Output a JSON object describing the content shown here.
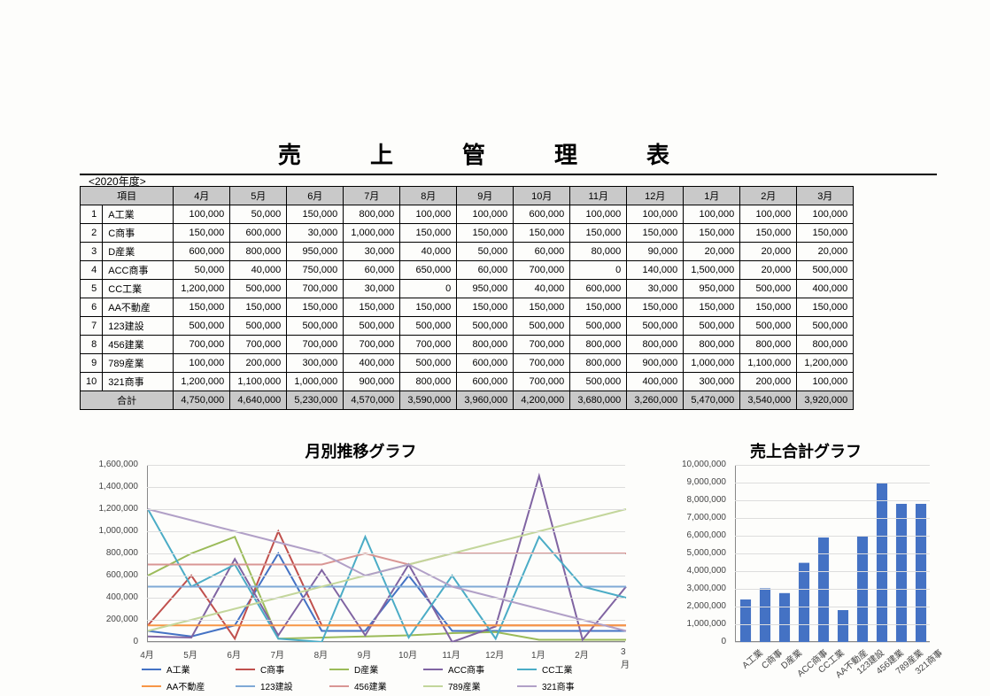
{
  "title": "売上管理表",
  "fiscal_label": "<2020年度>",
  "header_item": "項目",
  "months": [
    "4月",
    "5月",
    "6月",
    "7月",
    "8月",
    "9月",
    "10月",
    "11月",
    "12月",
    "1月",
    "2月",
    "3月"
  ],
  "rows": [
    {
      "idx": 1,
      "name": "A工業",
      "vals": [
        100000,
        50000,
        150000,
        800000,
        100000,
        100000,
        600000,
        100000,
        100000,
        100000,
        100000,
        100000
      ]
    },
    {
      "idx": 2,
      "name": "C商事",
      "vals": [
        150000,
        600000,
        30000,
        1000000,
        150000,
        150000,
        150000,
        150000,
        150000,
        150000,
        150000,
        150000
      ]
    },
    {
      "idx": 3,
      "name": "D産業",
      "vals": [
        600000,
        800000,
        950000,
        30000,
        40000,
        50000,
        60000,
        80000,
        90000,
        20000,
        20000,
        20000
      ]
    },
    {
      "idx": 4,
      "name": "ACC商事",
      "vals": [
        50000,
        40000,
        750000,
        60000,
        650000,
        60000,
        700000,
        0,
        140000,
        1500000,
        20000,
        500000
      ]
    },
    {
      "idx": 5,
      "name": "CC工業",
      "vals": [
        1200000,
        500000,
        700000,
        30000,
        0,
        950000,
        40000,
        600000,
        30000,
        950000,
        500000,
        400000
      ]
    },
    {
      "idx": 6,
      "name": "AA不動産",
      "vals": [
        150000,
        150000,
        150000,
        150000,
        150000,
        150000,
        150000,
        150000,
        150000,
        150000,
        150000,
        150000
      ]
    },
    {
      "idx": 7,
      "name": "123建設",
      "vals": [
        500000,
        500000,
        500000,
        500000,
        500000,
        500000,
        500000,
        500000,
        500000,
        500000,
        500000,
        500000
      ]
    },
    {
      "idx": 8,
      "name": "456建業",
      "vals": [
        700000,
        700000,
        700000,
        700000,
        700000,
        800000,
        700000,
        800000,
        800000,
        800000,
        800000,
        800000
      ]
    },
    {
      "idx": 9,
      "name": "789産業",
      "vals": [
        100000,
        200000,
        300000,
        400000,
        500000,
        600000,
        700000,
        800000,
        900000,
        1000000,
        1100000,
        1200000
      ]
    },
    {
      "idx": 10,
      "name": "321商事",
      "vals": [
        1200000,
        1100000,
        1000000,
        900000,
        800000,
        600000,
        700000,
        500000,
        400000,
        300000,
        200000,
        100000
      ]
    }
  ],
  "total_label": "合計",
  "totals": [
    4750000,
    4640000,
    5230000,
    4570000,
    3590000,
    3960000,
    4200000,
    3680000,
    3260000,
    5470000,
    3540000,
    3920000
  ],
  "line_chart_title": "月別推移グラフ",
  "bar_chart_title": "売上合計グラフ",
  "chart_data": [
    {
      "type": "line",
      "title": "月別推移グラフ",
      "categories": [
        "4月",
        "5月",
        "6月",
        "7月",
        "8月",
        "9月",
        "10月",
        "11月",
        "12月",
        "1月",
        "2月",
        "3月"
      ],
      "ylim": [
        0,
        1600000
      ],
      "ytick_step": 200000,
      "series": [
        {
          "name": "A工業",
          "color": "#4472c4",
          "values": [
            100000,
            50000,
            150000,
            800000,
            100000,
            100000,
            600000,
            100000,
            100000,
            100000,
            100000,
            100000
          ]
        },
        {
          "name": "C商事",
          "color": "#c0504d",
          "values": [
            150000,
            600000,
            30000,
            1000000,
            150000,
            150000,
            150000,
            150000,
            150000,
            150000,
            150000,
            150000
          ]
        },
        {
          "name": "D産業",
          "color": "#9bbb59",
          "values": [
            600000,
            800000,
            950000,
            30000,
            40000,
            50000,
            60000,
            80000,
            90000,
            20000,
            20000,
            20000
          ]
        },
        {
          "name": "ACC商事",
          "color": "#8064a2",
          "values": [
            50000,
            40000,
            750000,
            60000,
            650000,
            60000,
            700000,
            0,
            140000,
            1500000,
            20000,
            500000
          ]
        },
        {
          "name": "CC工業",
          "color": "#4bacc6",
          "values": [
            1200000,
            500000,
            700000,
            30000,
            0,
            950000,
            40000,
            600000,
            30000,
            950000,
            500000,
            400000
          ]
        },
        {
          "name": "AA不動産",
          "color": "#f79646",
          "values": [
            150000,
            150000,
            150000,
            150000,
            150000,
            150000,
            150000,
            150000,
            150000,
            150000,
            150000,
            150000
          ]
        },
        {
          "name": "123建設",
          "color": "#7fa9d6",
          "values": [
            500000,
            500000,
            500000,
            500000,
            500000,
            500000,
            500000,
            500000,
            500000,
            500000,
            500000,
            500000
          ]
        },
        {
          "name": "456建業",
          "color": "#d99694",
          "values": [
            700000,
            700000,
            700000,
            700000,
            700000,
            800000,
            700000,
            800000,
            800000,
            800000,
            800000,
            800000
          ]
        },
        {
          "name": "789産業",
          "color": "#c3d69b",
          "values": [
            100000,
            200000,
            300000,
            400000,
            500000,
            600000,
            700000,
            800000,
            900000,
            1000000,
            1100000,
            1200000
          ]
        },
        {
          "name": "321商事",
          "color": "#b1a0c7",
          "values": [
            1200000,
            1100000,
            1000000,
            900000,
            800000,
            600000,
            700000,
            500000,
            400000,
            300000,
            200000,
            100000
          ]
        }
      ]
    },
    {
      "type": "bar",
      "title": "売上合計グラフ",
      "categories": [
        "A工業",
        "C商事",
        "D産業",
        "ACC商事",
        "CC工業",
        "AA不動産",
        "123建設",
        "456建業",
        "789産業",
        "321商事"
      ],
      "ylim": [
        0,
        10000000
      ],
      "ytick_step": 1000000,
      "values": [
        2400000,
        3030000,
        2760000,
        4470000,
        5900000,
        1800000,
        6000000,
        9000000,
        7800000,
        7800000
      ],
      "color": "#4472c4"
    }
  ]
}
